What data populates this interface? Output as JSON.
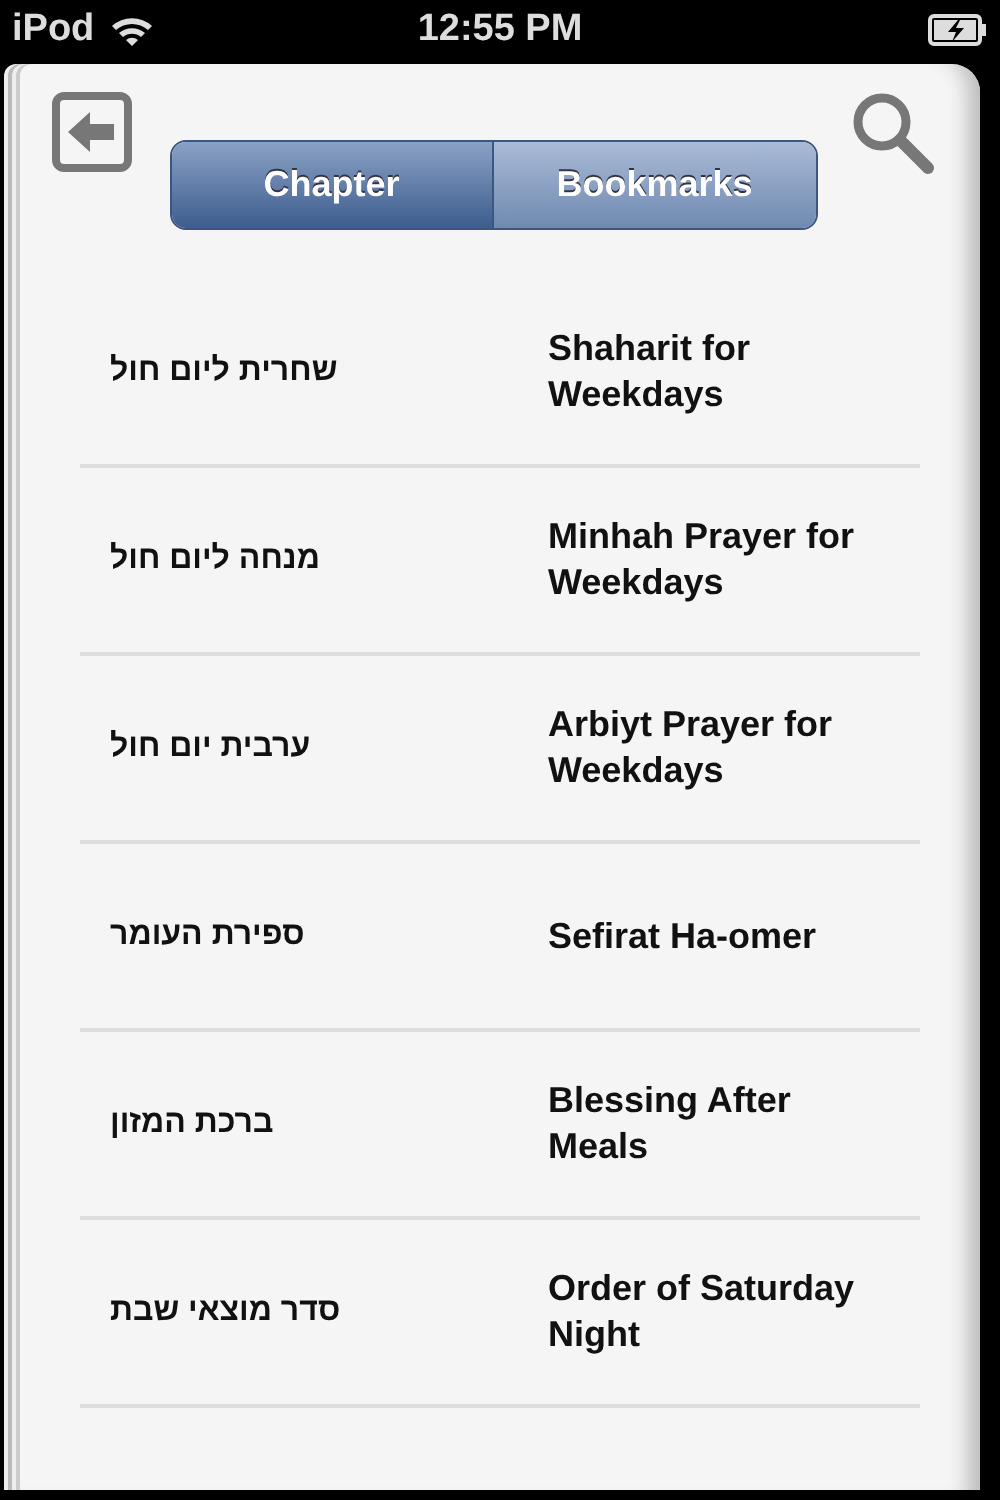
{
  "status_bar": {
    "carrier": "iPod",
    "time": "12:55 PM"
  },
  "segments": [
    {
      "label": "Chapter",
      "selected": true
    },
    {
      "label": "Bookmarks",
      "selected": false
    }
  ],
  "chapters": [
    {
      "hebrew": "שחרית ליום חול",
      "english": "Shaharit for Weekdays"
    },
    {
      "hebrew": "מנחה ליום חול",
      "english": "Minhah Prayer for Weekdays"
    },
    {
      "hebrew": "ערבית יום חול",
      "english": "Arbiyt Prayer for Weekdays"
    },
    {
      "hebrew": "ספירת העומר",
      "english": "Sefirat Ha-omer"
    },
    {
      "hebrew": "ברכת המזון",
      "english": "Blessing After Meals"
    },
    {
      "hebrew": "סדר מוצאי שבת",
      "english": "Order of Saturday Night"
    }
  ]
}
